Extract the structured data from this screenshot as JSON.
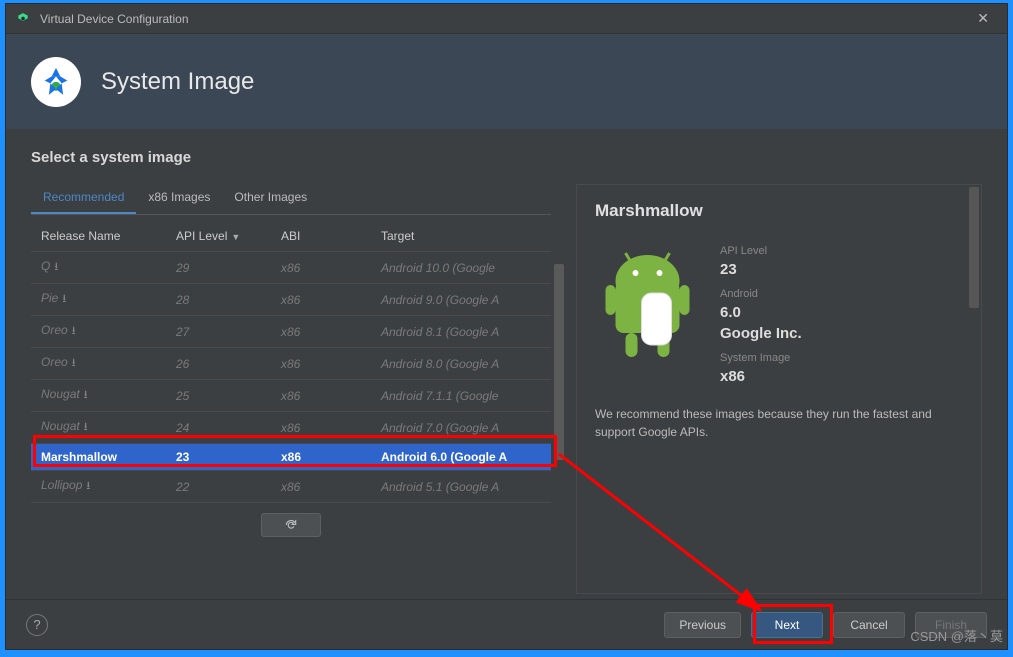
{
  "titlebar": {
    "title": "Virtual Device Configuration"
  },
  "banner": {
    "heading": "System Image"
  },
  "subheading": "Select a system image",
  "tabs": [
    {
      "label": "Recommended",
      "active": true
    },
    {
      "label": "x86 Images",
      "active": false
    },
    {
      "label": "Other Images",
      "active": false
    }
  ],
  "columns": {
    "c0": "Release Name",
    "c1": "API Level",
    "c2": "ABI",
    "c3": "Target"
  },
  "rows": [
    {
      "name": "Q",
      "dl": true,
      "api": "29",
      "abi": "x86",
      "target": "Android 10.0 (Google",
      "sel": false
    },
    {
      "name": "Pie",
      "dl": true,
      "api": "28",
      "abi": "x86",
      "target": "Android 9.0 (Google A",
      "sel": false
    },
    {
      "name": "Oreo",
      "dl": true,
      "api": "27",
      "abi": "x86",
      "target": "Android 8.1 (Google A",
      "sel": false
    },
    {
      "name": "Oreo",
      "dl": true,
      "api": "26",
      "abi": "x86",
      "target": "Android 8.0 (Google A",
      "sel": false
    },
    {
      "name": "Nougat",
      "dl": true,
      "api": "25",
      "abi": "x86",
      "target": "Android 7.1.1 (Google",
      "sel": false
    },
    {
      "name": "Nougat",
      "dl": true,
      "api": "24",
      "abi": "x86",
      "target": "Android 7.0 (Google A",
      "sel": false
    },
    {
      "name": "Marshmallow",
      "dl": false,
      "api": "23",
      "abi": "x86",
      "target": "Android 6.0 (Google A",
      "sel": true
    },
    {
      "name": "Lollipop",
      "dl": true,
      "api": "22",
      "abi": "x86",
      "target": "Android 5.1 (Google A",
      "sel": false
    }
  ],
  "detail": {
    "title": "Marshmallow",
    "api_label": "API Level",
    "api": "23",
    "android_label": "Android",
    "android": "6.0",
    "vendor": "Google Inc.",
    "sysimg_label": "System Image",
    "sysimg": "x86",
    "note": "We recommend these images because they run the fastest and support Google APIs."
  },
  "buttons": {
    "previous": "Previous",
    "next": "Next",
    "cancel": "Cancel",
    "finish": "Finish"
  },
  "watermark": "CSDN @落丶莫"
}
